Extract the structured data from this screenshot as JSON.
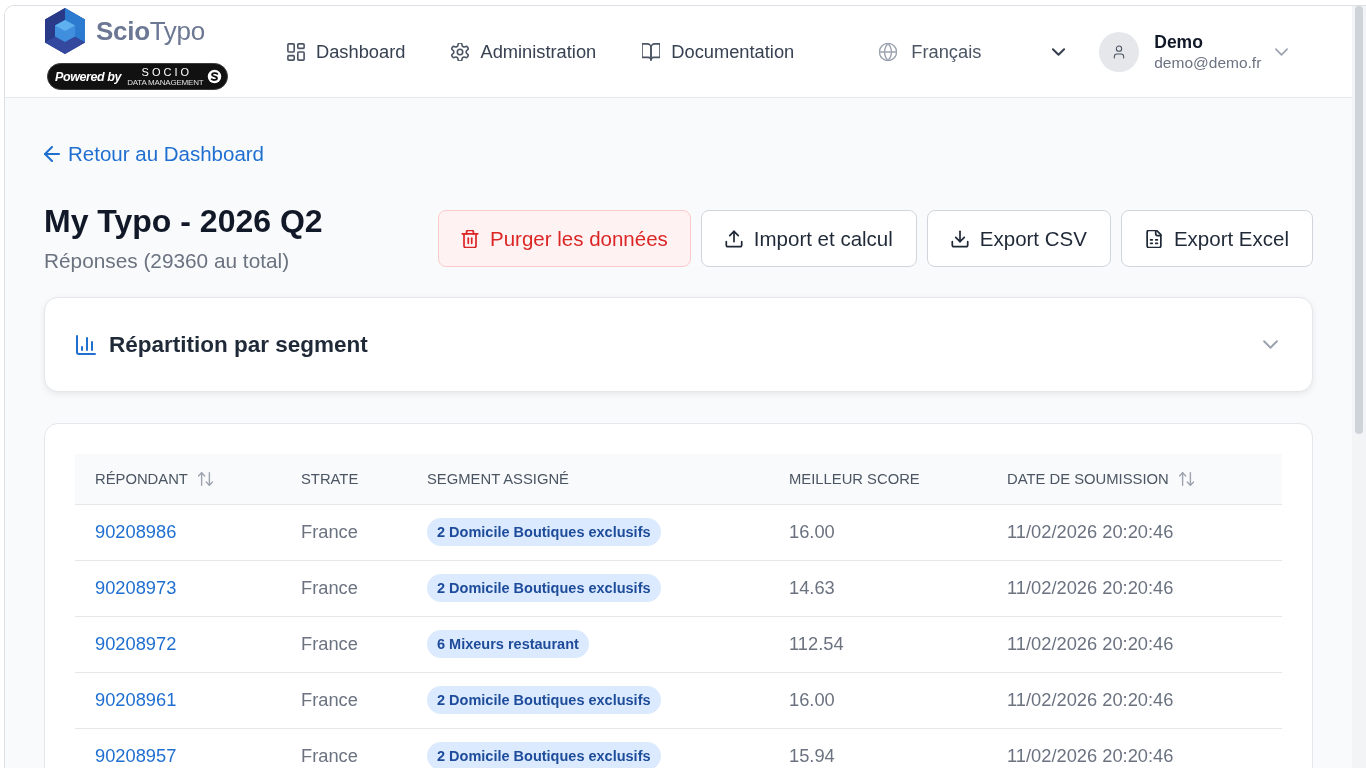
{
  "header": {
    "logo": {
      "name": "**Scio**Typo",
      "powered_by": "Powered by",
      "partner": "SOCIO",
      "partner_tagline": "DATA MANAGEMENT"
    },
    "nav": [
      {
        "kind": "dashboard",
        "label": "Dashboard"
      },
      {
        "kind": "settings",
        "label": "Administration"
      },
      {
        "kind": "docs",
        "label": "Documentation"
      }
    ],
    "language": {
      "label": "Français"
    },
    "user": {
      "name": "Demo",
      "email": "demo@demo.fr"
    }
  },
  "back_link": {
    "label": "Retour au Dashboard"
  },
  "page_title": "My Typo - 2026 Q2",
  "subtitle": "Réponses (29360 au total)",
  "actions": [
    {
      "kind": "danger",
      "label": "Purger les données"
    },
    {
      "kind": "upload",
      "label": "Import et calcul"
    },
    {
      "kind": "download",
      "label": "Export CSV"
    },
    {
      "kind": "sheet",
      "label": "Export Excel"
    }
  ],
  "segment_panel": {
    "title": "Répartition par segment",
    "expanded": false
  },
  "table": {
    "columns": [
      {
        "label": "RÉPONDANT",
        "sortable": true
      },
      {
        "label": "STRATE",
        "sortable": false
      },
      {
        "label": "SEGMENT ASSIGNÉ",
        "sortable": false
      },
      {
        "label": "MEILLEUR SCORE",
        "sortable": false
      },
      {
        "label": "DATE DE SOUMISSION",
        "sortable": true
      }
    ],
    "rows": [
      {
        "respondent": "90208986",
        "strata": "France",
        "segment": "2 Domicile Boutiques exclusifs",
        "best_score": "16.00",
        "submitted_at": "11/02/2026 20:20:46"
      },
      {
        "respondent": "90208973",
        "strata": "France",
        "segment": "2 Domicile Boutiques exclusifs",
        "best_score": "14.63",
        "submitted_at": "11/02/2026 20:20:46"
      },
      {
        "respondent": "90208972",
        "strata": "France",
        "segment": "6 Mixeurs restaurant",
        "best_score": "112.54",
        "submitted_at": "11/02/2026 20:20:46"
      },
      {
        "respondent": "90208961",
        "strata": "France",
        "segment": "2 Domicile Boutiques exclusifs",
        "best_score": "16.00",
        "submitted_at": "11/02/2026 20:20:46"
      },
      {
        "respondent": "90208957",
        "strata": "France",
        "segment": "2 Domicile Boutiques exclusifs",
        "best_score": "15.94",
        "submitted_at": "11/02/2026 20:20:46"
      }
    ]
  }
}
